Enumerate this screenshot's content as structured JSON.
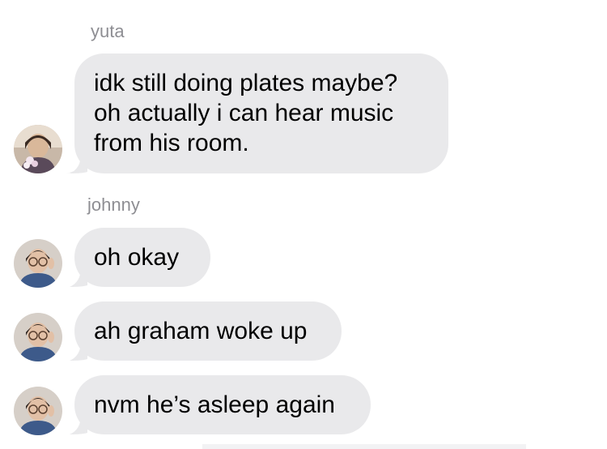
{
  "messages": [
    {
      "sender": "yuta",
      "show_sender": true,
      "lines": [
        "idk still doing plates maybe?",
        "oh actually i can hear music",
        "from his room."
      ],
      "avatar_icon": "avatar-yuta"
    },
    {
      "sender": "johnny",
      "show_sender": true,
      "lines": [
        "oh okay"
      ],
      "avatar_icon": "avatar-johnny"
    },
    {
      "sender": "johnny",
      "show_sender": false,
      "lines": [
        "ah graham woke up"
      ],
      "avatar_icon": "avatar-johnny"
    },
    {
      "sender": "johnny",
      "show_sender": false,
      "lines": [
        "nvm he’s asleep again"
      ],
      "avatar_icon": "avatar-johnny"
    }
  ],
  "colors": {
    "bubble": "#e9e9eb",
    "sender_name": "#8e8e93",
    "text": "#000000"
  }
}
